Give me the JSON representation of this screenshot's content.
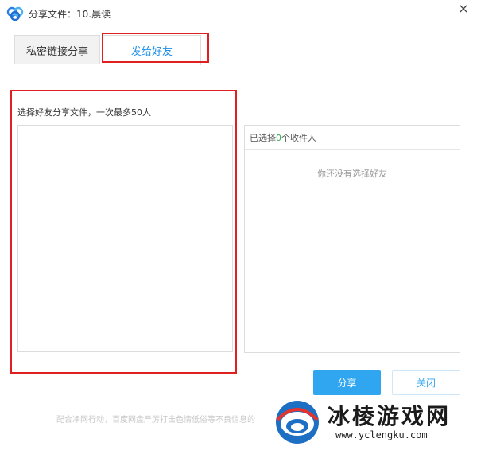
{
  "window": {
    "title": "分享文件：10.晨读",
    "close_glyph": "×"
  },
  "tabs": [
    {
      "label": "私密链接分享",
      "active": false
    },
    {
      "label": "发给好友",
      "active": true
    }
  ],
  "left_panel": {
    "hint": "选择好友分享文件，一次最多50人"
  },
  "right_panel": {
    "header_prefix": "已选择",
    "header_count": "0",
    "header_suffix": "个收件人",
    "empty_text": "你还没有选择好友"
  },
  "buttons": {
    "share": "分享",
    "close": "关闭"
  },
  "footer": {
    "text": "配合净网行动，百度网盘严厉打击色情低俗等不良信息的"
  },
  "watermark": {
    "name": "冰棱游戏网",
    "url": "www.yclengku.com"
  },
  "colors": {
    "accent": "#2fa6ef",
    "highlight": "#e02020",
    "count_green": "#2bb24c"
  },
  "icons": {
    "app": "baidu-netdisk-cloud-icon",
    "close": "close-icon"
  }
}
